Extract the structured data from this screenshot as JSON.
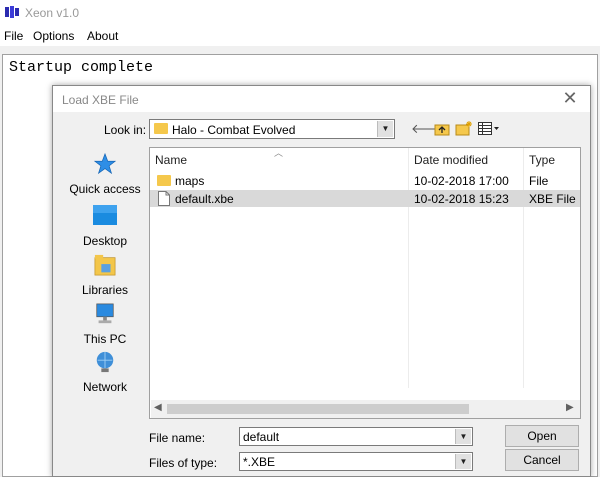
{
  "app": {
    "title": "Xeon v1.0"
  },
  "menu": {
    "items": [
      "File",
      "Options",
      "About"
    ]
  },
  "console": {
    "text": "Startup complete"
  },
  "dialog": {
    "title": "Load XBE File",
    "close_glyph": "✕",
    "look_in_label": "Look in:",
    "look_in_value": "Halo - Combat Evolved",
    "places": [
      "Quick access",
      "Desktop",
      "Libraries",
      "This PC",
      "Network"
    ],
    "columns": [
      "Name",
      "Date modified",
      "Type"
    ],
    "files": [
      {
        "name": "maps",
        "date": "10-02-2018 17:00",
        "type": "File folder",
        "icon": "folder-icon"
      },
      {
        "name": "default.xbe",
        "date": "10-02-2018 15:23",
        "type": "XBE File",
        "icon": "file-icon",
        "selected": true
      }
    ],
    "file_name_label": "File name:",
    "file_name_value": "default",
    "file_type_label": "Files of type:",
    "file_type_value": "*.XBE",
    "open_label": "Open",
    "cancel_label": "Cancel"
  },
  "colors": {
    "selection": "#d9d9d9",
    "folder": "#f5c84c",
    "accent": "#1e7bd4"
  }
}
